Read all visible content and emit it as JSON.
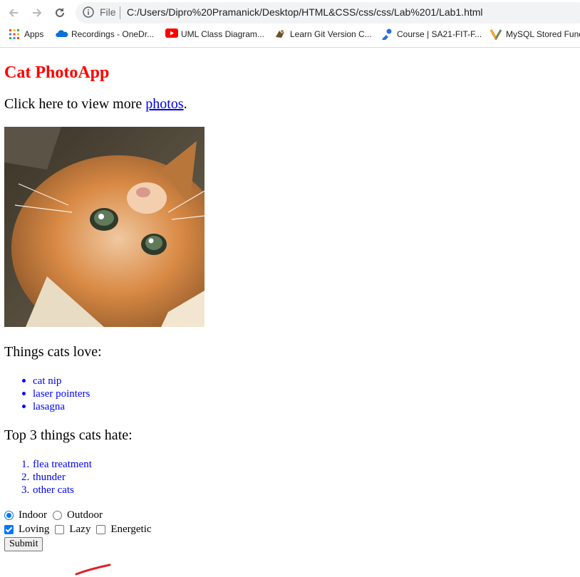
{
  "browser": {
    "scheme": "File",
    "url": "C:/Users/Dipro%20Pramanick/Desktop/HTML&CSS/css/css/Lab%201/Lab1.html",
    "bookmarks": [
      {
        "label": "Apps",
        "icon": "apps-grid-icon"
      },
      {
        "label": "Recordings - OneDr...",
        "icon": "onedrive-icon"
      },
      {
        "label": "UML Class Diagram...",
        "icon": "youtube-icon"
      },
      {
        "label": "Learn Git Version C...",
        "icon": "course-icon"
      },
      {
        "label": "Course | SA21-FIT-F...",
        "icon": "course-link-icon"
      },
      {
        "label": "MySQL Stored Func",
        "icon": "gmail-icon"
      }
    ]
  },
  "page": {
    "title": "Cat PhotoApp",
    "intro_prefix": "Click here to view more ",
    "intro_link": "photos",
    "intro_suffix": ".",
    "love_heading": "Things cats love:",
    "love_items": [
      "cat nip",
      "laser pointers",
      "lasagna"
    ],
    "hate_heading": "Top 3 things cats hate:",
    "hate_items": [
      "flea treatment",
      "thunder",
      "other cats"
    ],
    "hate_numbers": [
      "1.",
      "2.",
      "3."
    ],
    "radio_options": [
      {
        "label": "Indoor",
        "checked": true
      },
      {
        "label": "Outdoor",
        "checked": false
      }
    ],
    "checkbox_options": [
      {
        "label": "Loving",
        "checked": true
      },
      {
        "label": "Lazy",
        "checked": false
      },
      {
        "label": "Energetic",
        "checked": false
      }
    ],
    "submit_label": "Submit"
  },
  "colors": {
    "title": "#ff0000",
    "list_text": "#0000ff",
    "link": "#0000ee",
    "control_accent": "#0075ff"
  }
}
